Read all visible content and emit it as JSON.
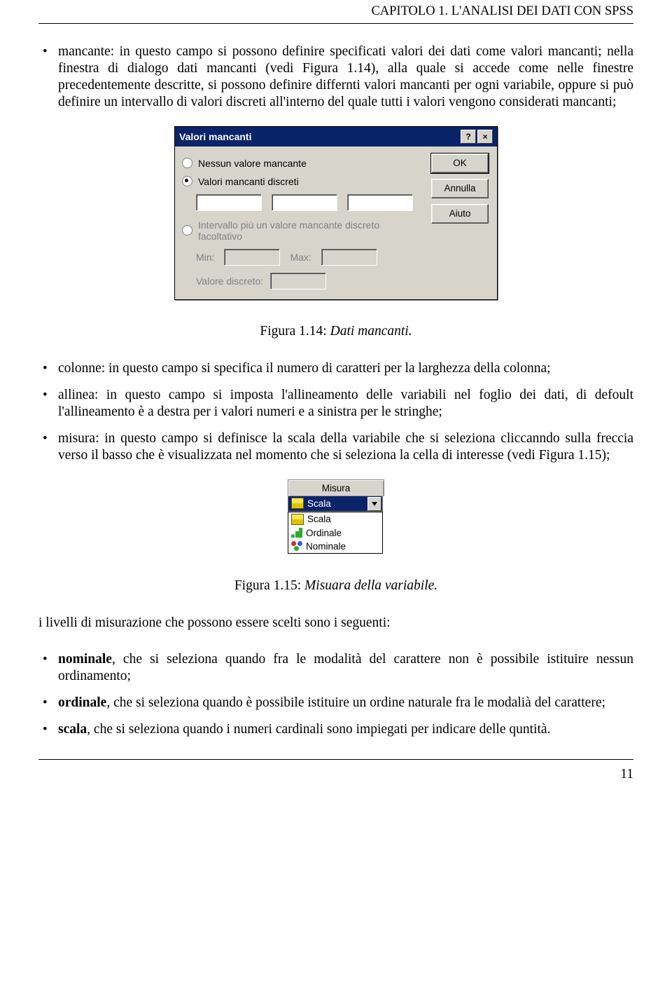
{
  "header": {
    "running": "CAPITOLO 1. L'ANALISI DEI DATI CON SPSS"
  },
  "bullets1": {
    "mancante": "mancante: in questo campo si possono definire specificati valori dei dati come valori mancanti; nella finestra di dialogo dati mancanti (vedi Figura 1.14), alla quale si accede come nelle finestre precedentemente descritte, si possono definire differnti valori mancanti per ogni variabile, oppure si può definire un intervallo di valori discreti all'interno del quale tutti i valori vengono considerati mancanti;"
  },
  "dialog1": {
    "title": "Valori mancanti",
    "help_btn": "?",
    "close_btn": "×",
    "radio_none": "Nessun valore mancante",
    "radio_discrete": "Valori mancanti discreti",
    "radio_range": "Intervallo più un valore mancante discreto facoltativo",
    "min_label": "Min:",
    "max_label": "Max:",
    "valdisc_label": "Valore discreto:",
    "btn_ok": "OK",
    "btn_cancel": "Annulla",
    "btn_help": "Aiuto"
  },
  "caption1": {
    "prefix": "Figura 1.14: ",
    "text": "Dati mancanti."
  },
  "bullets2": {
    "colonne": "colonne: in questo campo si specifica il numero di caratteri per la larghezza della colonna;",
    "allinea": "allinea: in questo campo si imposta l'allineamento delle variabili nel foglio dei dati, di defoult l'allineamento è a destra per i valori numeri e a sinistra per le stringhe;",
    "misura": "misura: in questo campo si definisce la scala della variabile che si seleziona cliccanndo sulla freccia verso il basso che è visualizzata nel momento che si seleziona la cella di interesse (vedi Figura 1.15);"
  },
  "dialog2": {
    "header": "Misura",
    "selected": "Scala",
    "options": {
      "scala": "Scala",
      "ordinale": "Ordinale",
      "nominale": "Nominale"
    }
  },
  "caption2": {
    "prefix": "Figura 1.15: ",
    "text": "Misuara della variabile."
  },
  "para_levels": "i livelli di misurazione che possono essere scelti sono i seguenti:",
  "bullets3": {
    "nominale_strong": "nominale",
    "nominale_rest": ", che si seleziona quando fra le modalità del carattere non è possibile istituire nessun ordinamento;",
    "ordinale_strong": "ordinale",
    "ordinale_rest": ", che si seleziona quando è possibile istituire un ordine naturale fra le modalià del carattere;",
    "scala_strong": "scala",
    "scala_rest": ", che si seleziona quando i numeri cardinali sono impiegati per indicare delle quntità."
  },
  "page_number": "11"
}
